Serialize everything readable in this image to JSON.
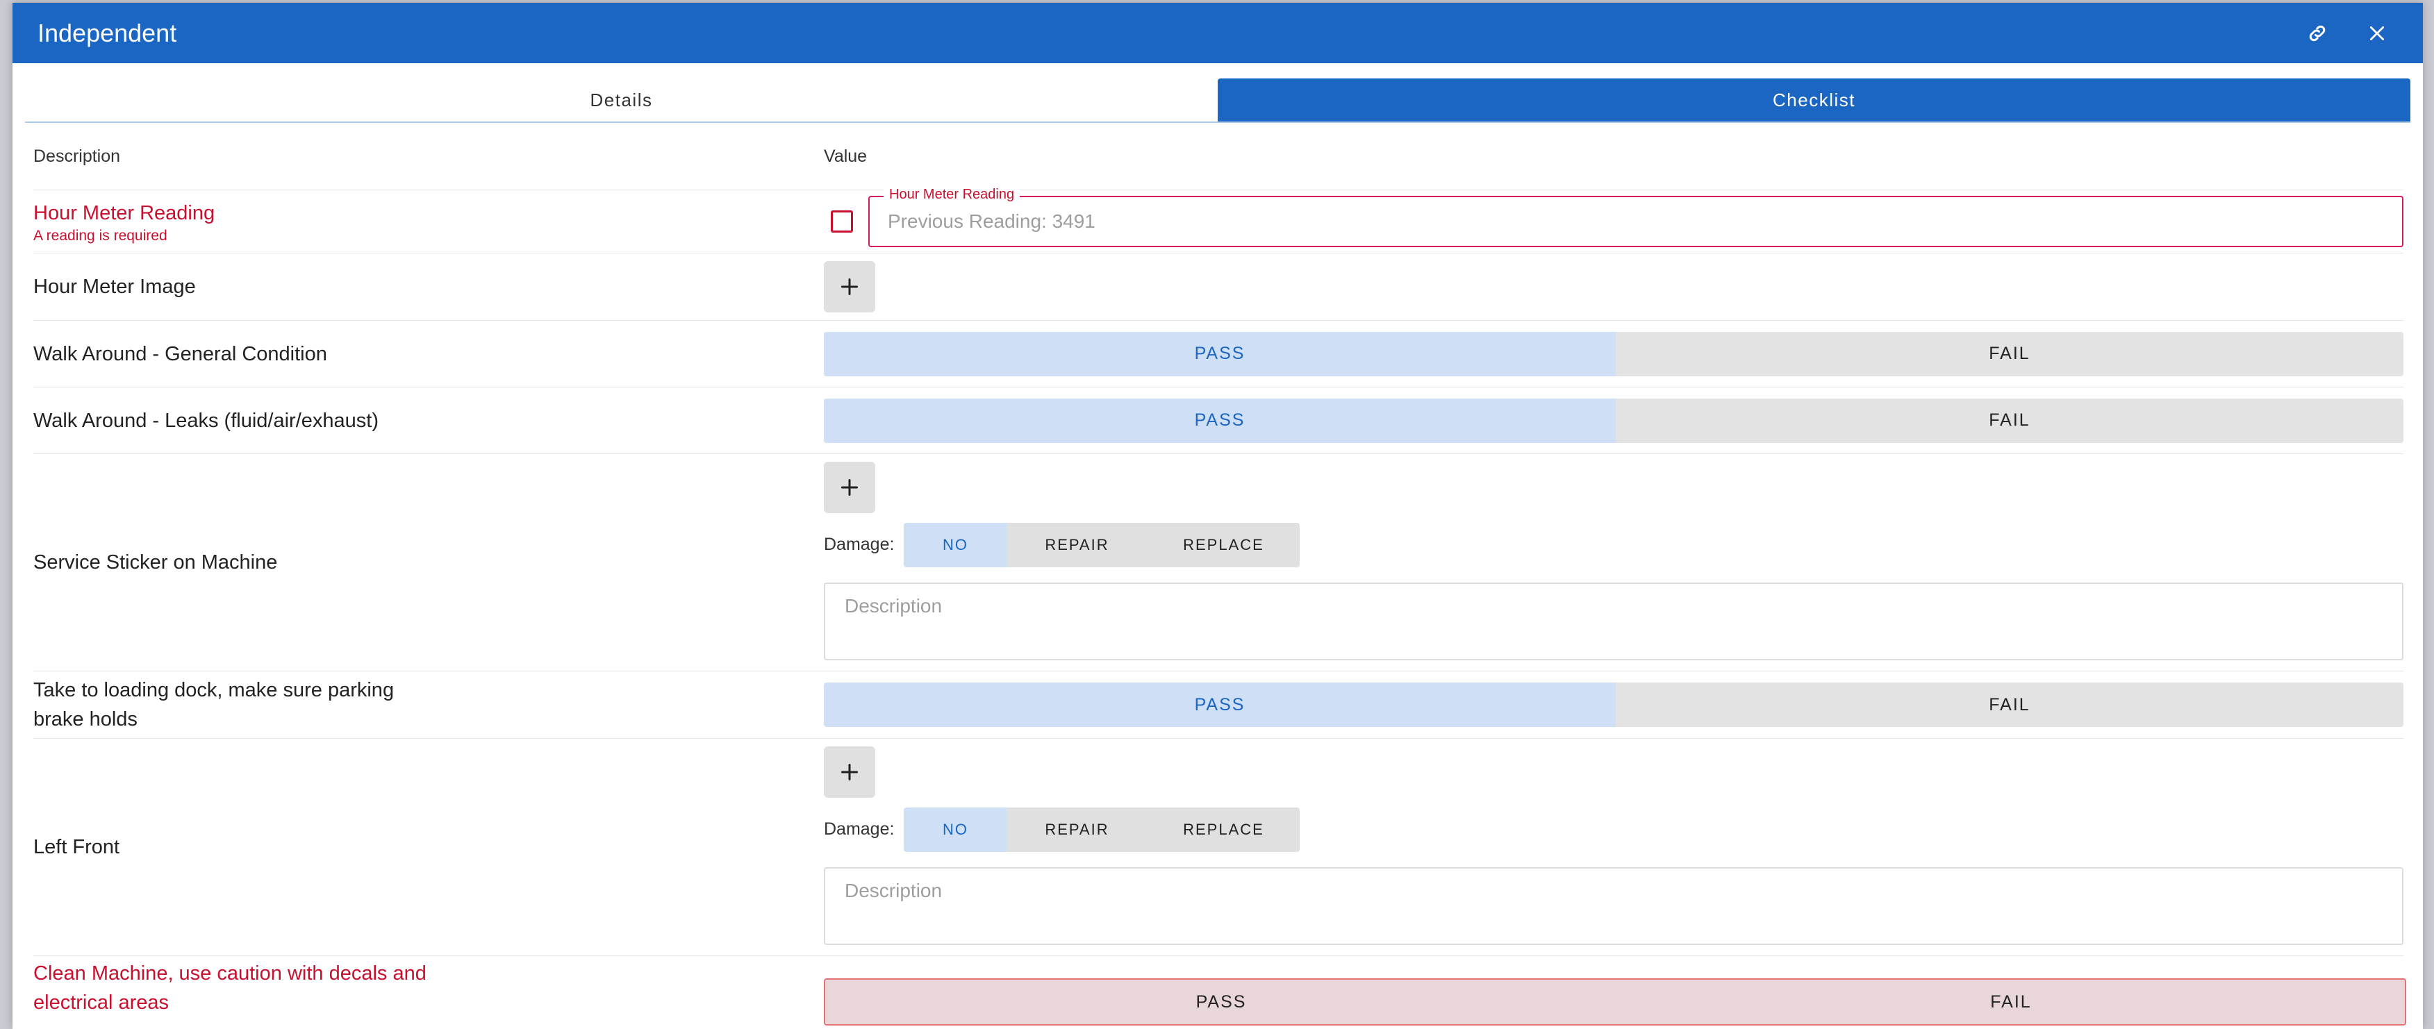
{
  "window": {
    "title": "Independent"
  },
  "tabs": [
    {
      "label": "Details",
      "active": false
    },
    {
      "label": "Checklist",
      "active": true
    }
  ],
  "columns": {
    "description": "Description",
    "value": "Value"
  },
  "hour_meter": {
    "label": "Hour Meter Reading",
    "error": "A reading is required",
    "field_legend": "Hour Meter Reading",
    "placeholder": "Previous Reading: 3491",
    "value": ""
  },
  "hour_meter_image": {
    "label": "Hour Meter Image"
  },
  "pass_label": "PASS",
  "fail_label": "FAIL",
  "damage": {
    "label": "Damage:",
    "options": [
      "NO",
      "REPAIR",
      "REPLACE"
    ],
    "selected": "NO",
    "description_placeholder": "Description"
  },
  "items": {
    "general_condition": {
      "label": "Walk Around - General Condition",
      "selected": "PASS"
    },
    "leaks": {
      "label": "Walk Around - Leaks (fluid/air/exhaust)",
      "selected": "PASS"
    },
    "service_sticker": {
      "label": "Service Sticker on Machine"
    },
    "loading_dock": {
      "label": "Take to loading dock, make sure parking brake holds",
      "selected": "PASS"
    },
    "left_front": {
      "label": "Left Front"
    },
    "clean_machine": {
      "label": "Clean Machine, use caution with decals and electrical areas",
      "selected": ""
    }
  },
  "colors": {
    "primary": "#1a66c2",
    "error": "#c8102e",
    "selected_bg": "#cfdff5",
    "neutral_bg": "#e3e3e3"
  },
  "icons": {
    "link": "link-icon",
    "close": "close-icon",
    "add": "plus-icon"
  }
}
